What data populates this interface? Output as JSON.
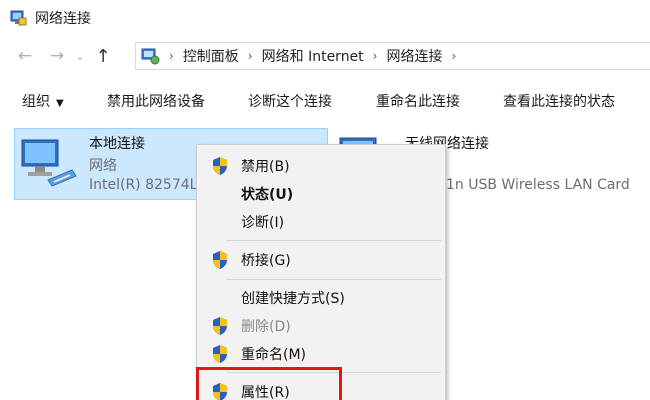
{
  "window": {
    "title": "网络连接"
  },
  "address": {
    "crumbs": [
      "控制面板",
      "网络和 Internet",
      "网络连接"
    ]
  },
  "commands": {
    "organize": "组织",
    "disable": "禁用此网络设备",
    "diagnose": "诊断这个连接",
    "rename": "重命名此连接",
    "status": "查看此连接的状态"
  },
  "items": [
    {
      "name": "本地连接",
      "type": "网络",
      "device": "Intel(R) 82574L"
    },
    {
      "name": "无线网络连接",
      "device": "1n USB Wireless LAN Card"
    }
  ],
  "context_menu": {
    "items": [
      {
        "label": "禁用(B)"
      },
      {
        "label": "状态(U)"
      },
      {
        "label": "诊断(I)"
      },
      {
        "label": "桥接(G)"
      },
      {
        "label": "创建快捷方式(S)"
      },
      {
        "label": "删除(D)"
      },
      {
        "label": "重命名(M)"
      },
      {
        "label": "属性(R)"
      }
    ]
  },
  "colors": {
    "selection_bg": "#cce8ff",
    "selection_border": "#99d1ff",
    "highlight_box": "#e01818",
    "menu_bg": "#f2f2f2"
  },
  "icons": {
    "app": "network-connections-icon",
    "address": "control-panel-icon",
    "menu": "uac-shield-icon",
    "item": "network-adapter-icon"
  }
}
